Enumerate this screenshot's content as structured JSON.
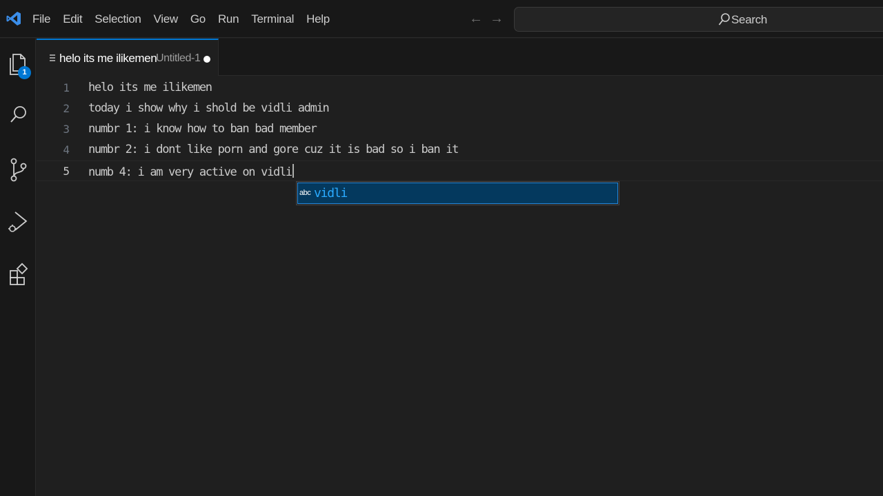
{
  "menu": [
    "File",
    "Edit",
    "Selection",
    "View",
    "Go",
    "Run",
    "Terminal",
    "Help"
  ],
  "nav": {
    "back_icon": "arrow-left-icon",
    "forward_icon": "arrow-right-icon"
  },
  "search": {
    "label": "Search"
  },
  "activity_bar": {
    "items": [
      "explorer-icon",
      "search-icon",
      "source-control-icon",
      "run-debug-icon",
      "extensions-icon"
    ],
    "explorer_badge": "1"
  },
  "tab": {
    "title": "helo its me ilikemen",
    "description": "Untitled-1"
  },
  "editor": {
    "lines": [
      {
        "number": "1",
        "text": "helo its me ilikemen"
      },
      {
        "number": "2",
        "text": "today i show why i shold be vidli admin"
      },
      {
        "number": "3",
        "text": "numbr 1: i know how to ban bad member"
      },
      {
        "number": "4",
        "text": "numbr 2: i dont like porn and gore cuz it is bad so i ban it"
      },
      {
        "number": "5",
        "text": "numb 4: i am very active on vidli"
      }
    ],
    "current_line": 5
  },
  "suggest": {
    "kind": "abc",
    "label": "vidli"
  },
  "colors": {
    "accent": "#0078d4",
    "background": "#1f1f1f",
    "suggest_highlight": "#2aaaff"
  }
}
